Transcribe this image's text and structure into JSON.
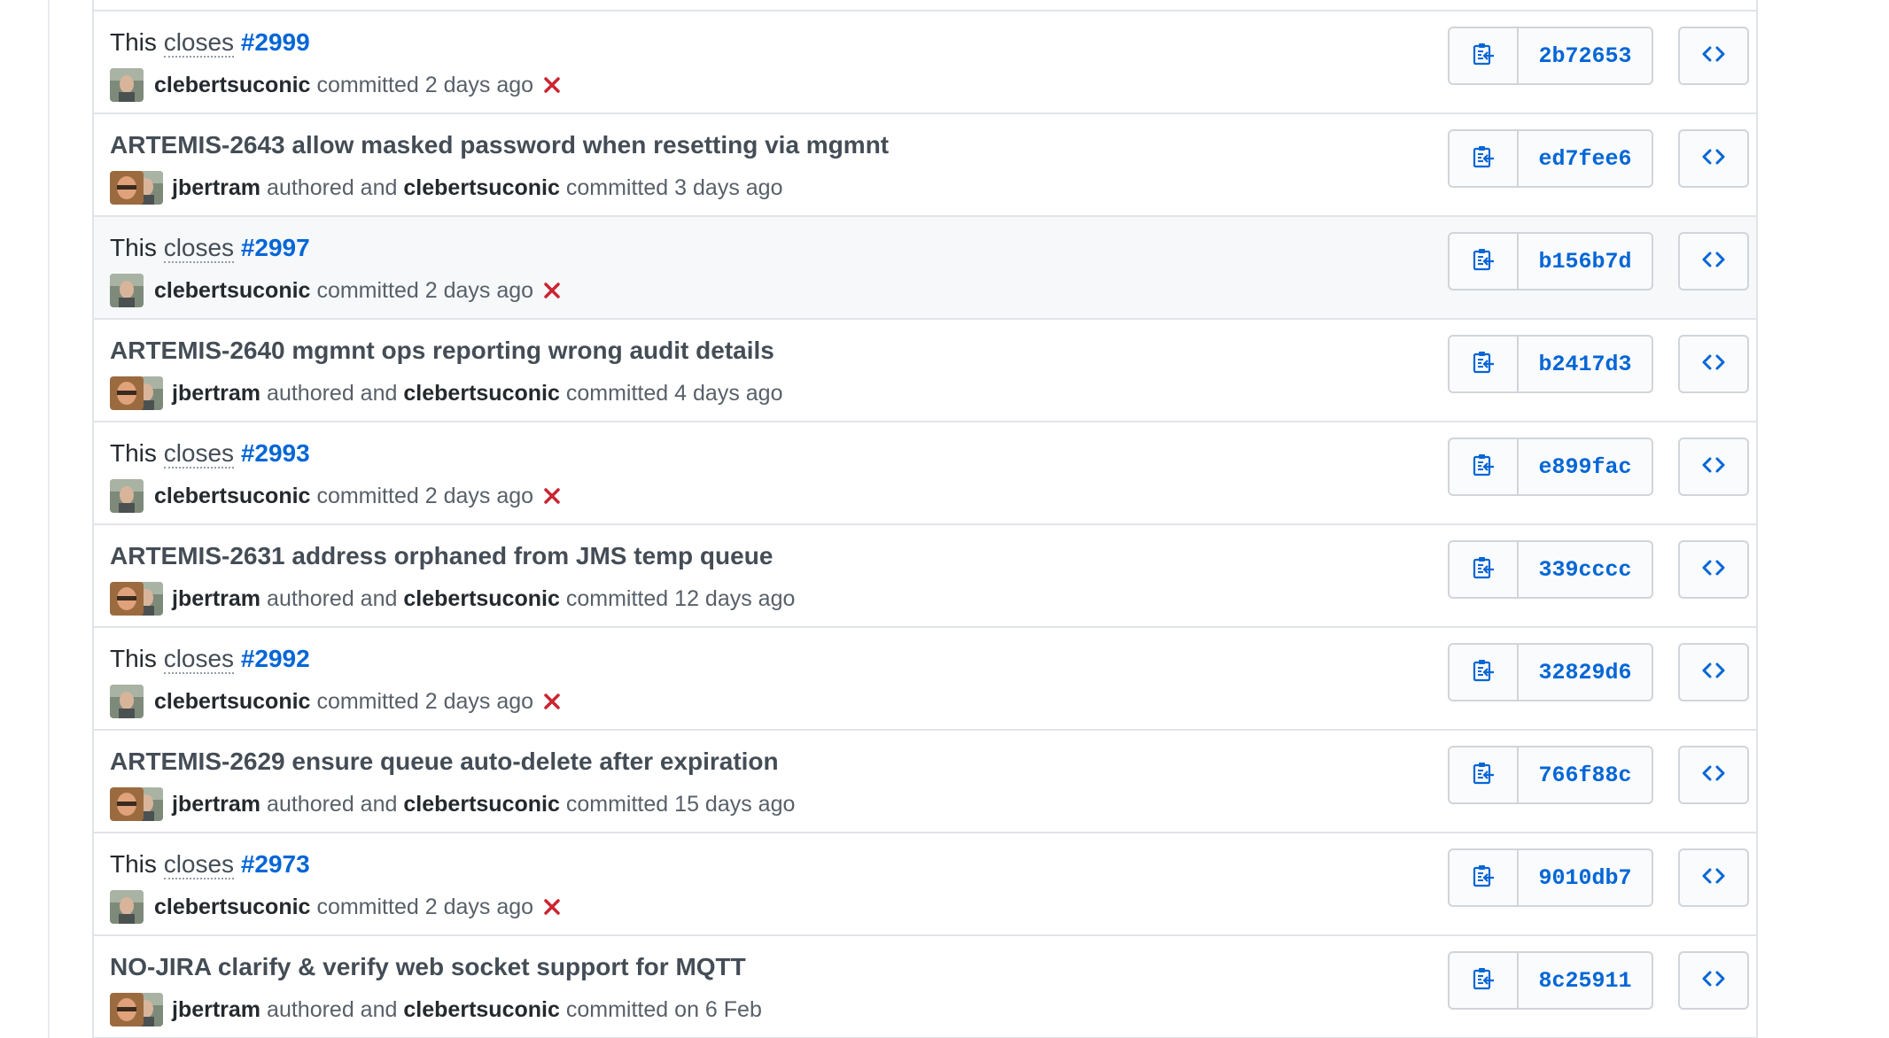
{
  "colors": {
    "link": "#0366d6",
    "failure": "#cb2431",
    "border": "#e1e4e8"
  },
  "icons": {
    "copy": "clipboard-icon",
    "browse": "code-icon",
    "failure": "x-icon"
  },
  "commits": [
    {
      "type": "closes",
      "prefix": "This",
      "closes_word": "closes",
      "issue": "#2999",
      "committer": "clebertsuconic",
      "committed_label": "committed",
      "time": "2 days ago",
      "status": "failure",
      "sha": "2b72653",
      "highlight": false
    },
    {
      "type": "authored",
      "message": "ARTEMIS-2643 allow masked password when resetting via mgmnt",
      "author": "jbertram",
      "authored_label": "authored and",
      "committer": "clebertsuconic",
      "committed_label": "committed",
      "time": "3 days ago",
      "sha": "ed7fee6",
      "highlight": false
    },
    {
      "type": "closes",
      "prefix": "This",
      "closes_word": "closes",
      "issue": "#2997",
      "committer": "clebertsuconic",
      "committed_label": "committed",
      "time": "2 days ago",
      "status": "failure",
      "sha": "b156b7d",
      "highlight": true
    },
    {
      "type": "authored",
      "message": "ARTEMIS-2640 mgmnt ops reporting wrong audit details",
      "author": "jbertram",
      "authored_label": "authored and",
      "committer": "clebertsuconic",
      "committed_label": "committed",
      "time": "4 days ago",
      "sha": "b2417d3",
      "highlight": false
    },
    {
      "type": "closes",
      "prefix": "This",
      "closes_word": "closes",
      "issue": "#2993",
      "committer": "clebertsuconic",
      "committed_label": "committed",
      "time": "2 days ago",
      "status": "failure",
      "sha": "e899fac",
      "highlight": false
    },
    {
      "type": "authored",
      "message": "ARTEMIS-2631 address orphaned from JMS temp queue",
      "author": "jbertram",
      "authored_label": "authored and",
      "committer": "clebertsuconic",
      "committed_label": "committed",
      "time": "12 days ago",
      "sha": "339cccc",
      "highlight": false
    },
    {
      "type": "closes",
      "prefix": "This",
      "closes_word": "closes",
      "issue": "#2992",
      "committer": "clebertsuconic",
      "committed_label": "committed",
      "time": "2 days ago",
      "status": "failure",
      "sha": "32829d6",
      "highlight": false
    },
    {
      "type": "authored",
      "message": "ARTEMIS-2629 ensure queue auto-delete after expiration",
      "author": "jbertram",
      "authored_label": "authored and",
      "committer": "clebertsuconic",
      "committed_label": "committed",
      "time": "15 days ago",
      "sha": "766f88c",
      "highlight": false
    },
    {
      "type": "closes",
      "prefix": "This",
      "closes_word": "closes",
      "issue": "#2973",
      "committer": "clebertsuconic",
      "committed_label": "committed",
      "time": "2 days ago",
      "status": "failure",
      "sha": "9010db7",
      "highlight": false
    },
    {
      "type": "authored",
      "message": "NO-JIRA clarify & verify web socket support for MQTT",
      "author": "jbertram",
      "authored_label": "authored and",
      "committer": "clebertsuconic",
      "committed_label": "committed",
      "time": "on 6 Feb",
      "sha": "8c25911",
      "highlight": false
    }
  ]
}
